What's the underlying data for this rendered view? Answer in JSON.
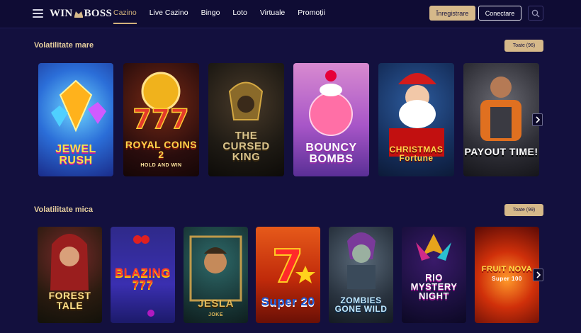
{
  "header": {
    "logo_left": "WIN",
    "logo_right": "BOSS",
    "nav": [
      "Cazino",
      "Live Cazino",
      "Bingo",
      "Loto",
      "Virtuale",
      "Promoții"
    ],
    "register_label": "Înregistrare",
    "login_label": "Conectare"
  },
  "sections": [
    {
      "title": "Volatilitate mare",
      "all_label": "Toate (96)",
      "games": [
        "JEWEL RUSH",
        "ROYAL COINS 2",
        "THE CURSED KING",
        "BOUNCY BOMBS",
        "CHRISTMAS Fortune",
        "PAYOUT TIME!"
      ],
      "subtitles": [
        "",
        "HOLD AND WIN",
        "",
        "",
        "",
        ""
      ]
    },
    {
      "title": "Volatilitate mica",
      "all_label": "Toate (99)",
      "games": [
        "FOREST TALE",
        "BLAZING 777",
        "JESLA",
        "Super 20",
        "ZOMBIES GONE WILD",
        "RIO MYSTERY NIGHT",
        "FRUIT NOVA"
      ],
      "subtitles": [
        "",
        "",
        "JOKE",
        "",
        "",
        "",
        "Super 100"
      ]
    }
  ],
  "colors": {
    "background": "#13103e",
    "accent": "#d6b98a",
    "active_nav": "#d2b27b"
  }
}
